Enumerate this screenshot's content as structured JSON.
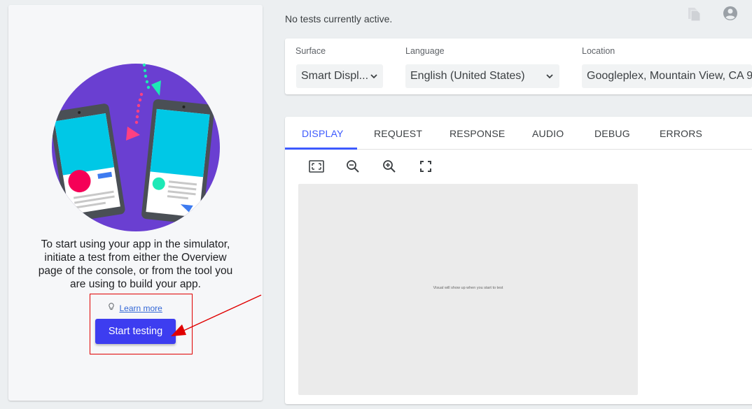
{
  "header": {
    "status": "No tests currently active.",
    "icons": [
      "copy-icon",
      "account-circle-icon"
    ]
  },
  "onboarding": {
    "intro_lines": [
      "To start using your app in the simulator,",
      "initiate a test from either the Overview",
      "page of the console, or from the tool you",
      "are using to build your app."
    ],
    "learn_more": "Learn more",
    "start_button": "Start testing"
  },
  "settings": {
    "surface": {
      "label": "Surface",
      "value": "Smart Displ..."
    },
    "language": {
      "label": "Language",
      "value": "English (United States)"
    },
    "location": {
      "label": "Location",
      "value": "Googleplex, Mountain View, CA 9"
    }
  },
  "tabs": [
    {
      "label": "DISPLAY",
      "active": true
    },
    {
      "label": "REQUEST",
      "active": false
    },
    {
      "label": "RESPONSE",
      "active": false
    },
    {
      "label": "AUDIO",
      "active": false
    },
    {
      "label": "DEBUG",
      "active": false
    },
    {
      "label": "ERRORS",
      "active": false
    }
  ],
  "toolbar": {
    "icons": [
      "fit-screen-icon",
      "zoom-out-icon",
      "zoom-in-icon",
      "fullscreen-icon"
    ]
  },
  "display": {
    "placeholder": "Visual will show up when you start to test"
  },
  "colors": {
    "accent": "#3d5afe",
    "button": "#3d3df0",
    "illustration_circle": "#6a3fd1",
    "annotation": "#e00000"
  }
}
